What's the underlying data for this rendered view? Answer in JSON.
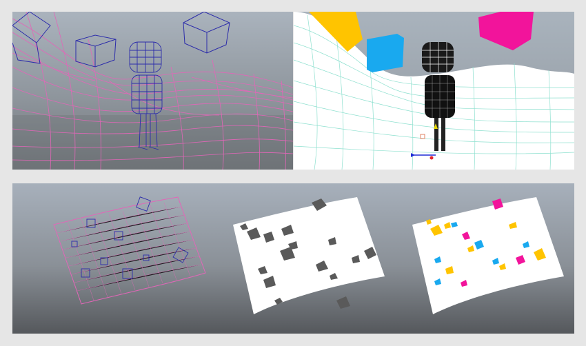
{
  "viewports": [
    {
      "id": "top-left",
      "mode": "wireframe",
      "content": [
        "terrain",
        "character",
        "cubes"
      ],
      "wire_color_terrain": "#e060b0",
      "wire_color_objects": "#2b2ba8"
    },
    {
      "id": "top-right",
      "mode": "shaded-with-wireframe",
      "content": [
        "terrain",
        "character",
        "cubes"
      ],
      "terrain_wire_color": "#7fe0c8",
      "cube_colors": [
        "#ffb400",
        "#1aa8f0",
        "#f0109a"
      ]
    },
    {
      "id": "bottom",
      "mode": "three-stage-comparison",
      "stages": [
        "wireframe",
        "gray-shaded",
        "colored"
      ]
    }
  ],
  "colors": {
    "yellow": "#ffc400",
    "cyan": "#19a9ef",
    "magenta": "#f2149b",
    "gray_cube": "#5a5a5a",
    "terrain_white": "#ffffff",
    "wire_pink": "#e266b8",
    "wire_blue": "#2c2caa"
  }
}
